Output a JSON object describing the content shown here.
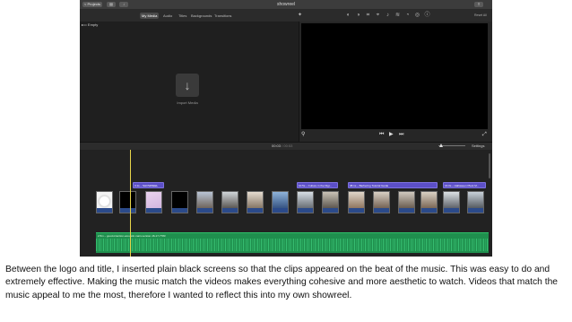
{
  "titlebar": {
    "back_label": "< Projects",
    "title": "showreel"
  },
  "toolbar": {
    "tabs": [
      {
        "label": "My Media",
        "active": true
      },
      {
        "label": "Audio",
        "active": false
      },
      {
        "label": "Titles",
        "active": false
      },
      {
        "label": "Backgrounds",
        "active": false
      },
      {
        "label": "Transitions",
        "active": false
      }
    ],
    "reset_all": "Reset All"
  },
  "browser": {
    "library_item": "Empty",
    "import_label": "Import Media"
  },
  "timeline_bar": {
    "timecode_current": "00:03",
    "timecode_total": "/ 00:53",
    "settings_label": "Settings"
  },
  "timeline": {
    "title_labels": [
      "3.1s – SHOWREEL",
      "10.5s – Culture in the Digi...",
      "38.1s – Barbering Tutorial Guide",
      "16.0s – Halloween Plant M..."
    ],
    "music_label": "2.5m – good-intention-acoustic-main-version-16-17-7783"
  },
  "caption": "Between the logo and title, I inserted plain black screens so that the clips appeared on the beat of the music. This was easy to do and extremely effective. Making the music match the videos makes everything cohesive and more aesthetic to watch. Videos that match the music appeal to me the most, therefore I wanted to reflect this into my own showreel.",
  "colors": {
    "title_clip": "#5c4fc7",
    "music_track": "#1f8f4e",
    "playhead": "#e8d64a"
  }
}
